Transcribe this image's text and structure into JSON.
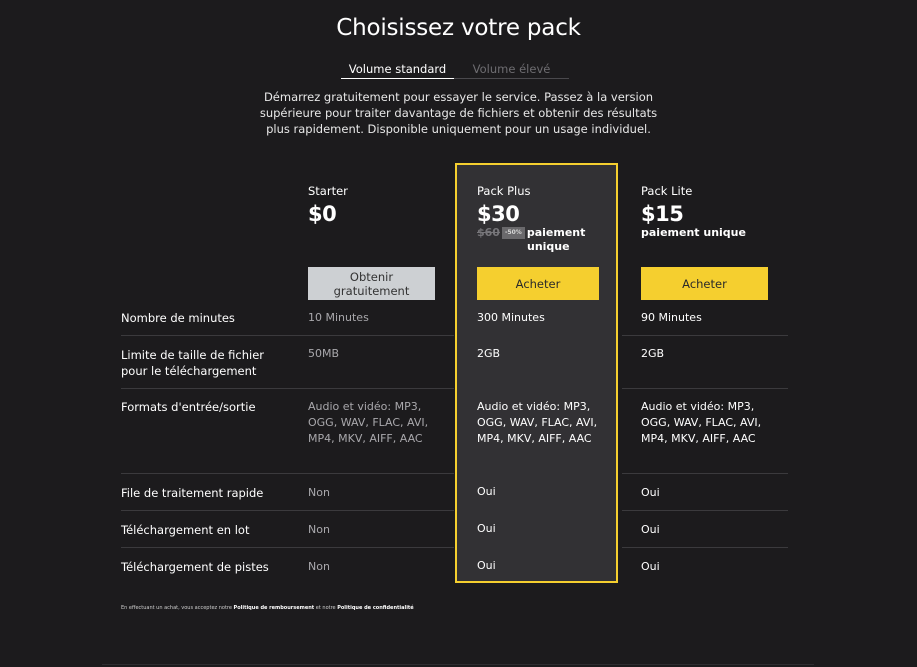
{
  "title": "Choisissez votre pack",
  "tabs": [
    {
      "label": "Volume standard",
      "active": true
    },
    {
      "label": "Volume élevé",
      "active": false
    }
  ],
  "intro": "Démarrez gratuitement pour essayer le service. Passez à la version supérieure pour traiter davantage de fichiers et obtenir des résultats plus rapidement. Disponible uniquement pour un usage individuel.",
  "plans": [
    {
      "name": "Starter",
      "price": "$0",
      "button": "Obtenir gratuitement"
    },
    {
      "name": "Pack Plus",
      "price": "$30",
      "old_price": "$60",
      "discount": "-50%",
      "sub_line1": "paiement",
      "sub_line2": "unique",
      "button": "Acheter",
      "highlighted": true
    },
    {
      "name": "Pack Lite",
      "price": "$15",
      "sub": "paiement unique",
      "button": "Acheter"
    }
  ],
  "rows": [
    {
      "label": "Nombre de minutes",
      "values": [
        "10 Minutes",
        "300 Minutes",
        "90 Minutes"
      ]
    },
    {
      "label": "Limite de taille de fichier pour le téléchargement",
      "values": [
        "50MB",
        "2GB",
        "2GB"
      ]
    },
    {
      "label": "Formats d'entrée/sortie",
      "values": [
        "Audio et vidéo: MP3, OGG, WAV, FLAC, AVI, MP4, MKV, AIFF, AAC",
        "Audio et vidéo: MP3, OGG, WAV, FLAC, AVI, MP4, MKV, AIFF, AAC",
        "Audio et vidéo: MP3, OGG, WAV, FLAC, AVI, MP4, MKV, AIFF, AAC"
      ]
    },
    {
      "label": "File de traitement rapide",
      "values": [
        "Non",
        "Oui",
        "Oui"
      ]
    },
    {
      "label": "Téléchargement en lot",
      "values": [
        "Non",
        "Oui",
        "Oui"
      ]
    },
    {
      "label": "Téléchargement de pistes",
      "values": [
        "Non",
        "Oui",
        "Oui"
      ]
    }
  ],
  "footnote": {
    "prefix": "En effectuant un achat, vous acceptez notre ",
    "refund_link": "Politique de remboursement",
    "middle": " et notre ",
    "privacy_link": "Politique de confidentialité"
  },
  "colors": {
    "background": "#1c1b1d",
    "accent": "#f5cf2f",
    "highlight_panel": "#323134",
    "free_button": "#cdd0d3"
  }
}
